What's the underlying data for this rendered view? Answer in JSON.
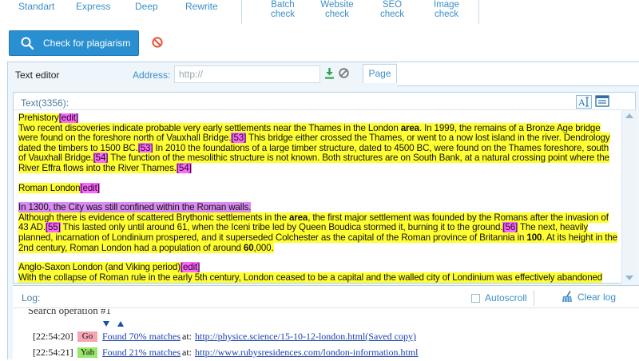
{
  "modes": [
    {
      "label": "Standart"
    },
    {
      "label": "Express"
    },
    {
      "label": "Deep"
    },
    {
      "label": "Rewrite"
    }
  ],
  "checks": [
    {
      "line1": "Batch",
      "line2": "check"
    },
    {
      "line1": "Website",
      "line2": "check"
    },
    {
      "line1": "SEO",
      "line2": "check"
    },
    {
      "line1": "Image",
      "line2": "check"
    }
  ],
  "actions": {
    "check_label": "Check for plagiarism"
  },
  "editor": {
    "tab_title": "Text editor",
    "address_label": "Address:",
    "address_placeholder": "http://",
    "page_tab": "Page",
    "text_count": "Text(3356):"
  },
  "content": {
    "p1_head": "Prehistory",
    "edit": "[edit]",
    "p1_a": "Two recent discoveries indicate probable very early settlements near the Thames in the London ",
    "w_area": "area",
    "p1_b": ". In 1999, the remains of a Bronze Age bridge were found on the foreshore north of Vauxhall Bridge.",
    "ref53": "[53]",
    "p1_c": " This bridge either crossed the Thames, or went to a now lost island in the river. Dendrology dated the timbers to 1500 BC.",
    "p1_d": " In 2010 the foundations of a large timber structure, dated to 4500 BC, were found on the Thames foreshore, south of Vauxhall Bridge.",
    "ref54": "[54]",
    "p1_e": " The function of the mesolithic structure is not known. Both structures are on South Bank, at a natural crossing point where the River Effra flows into the River Thames.",
    "p2_head": "Roman London",
    "p3_a": "In 1300, the City was still confined within the Roman walls.",
    "p3_b": "Although there is evidence of scattered Brythonic settlements in the ",
    "p3_c": ", the first major settlement was founded by the Romans after the invasion of 43 AD.",
    "ref55": "[55]",
    "p3_d": " This lasted only until around 61, when the Iceni tribe led by Queen Boudica stormed it, burning it to the ground.",
    "ref56": "[56]",
    "p3_e": " The next, heavily planned, incarnation of Londinium prospered, and it superseded Colchester as the capital of the Roman province of Britannia in ",
    "w_100": "100",
    "p3_f": ". At its height in the 2nd century, Roman London had a population of around ",
    "w_60": "60",
    "p3_g": ",000.",
    "p4_head": "Anglo-Saxon London (and Viking period)",
    "p4_a": "With the collapse of Roman rule in the early 5th century, London ceased to be a capital and the walled city of Londinium was effectively abandoned"
  },
  "log": {
    "label": "Log:",
    "autoscroll": "Autoscroll",
    "clear": "Clear log",
    "operation": "Search operation #1",
    "rows": [
      {
        "time": "[22:54:20]",
        "engine": "Go",
        "found": "Found 70% matches",
        "at": "at:",
        "url": "http://physice.science/15-10-12-london.html(Saved copy)"
      },
      {
        "time": "[22:54:21]",
        "engine": "Yah",
        "found": "Found 21% matches",
        "at": "at:",
        "url": "http://www.rubysresidences.com/london-information.html"
      }
    ]
  },
  "colors": {
    "accent": "#2a8fd0",
    "highlight": "#ffff33",
    "ref_highlight": "#ff66ff",
    "sentence_highlight": "#d98bf2"
  }
}
